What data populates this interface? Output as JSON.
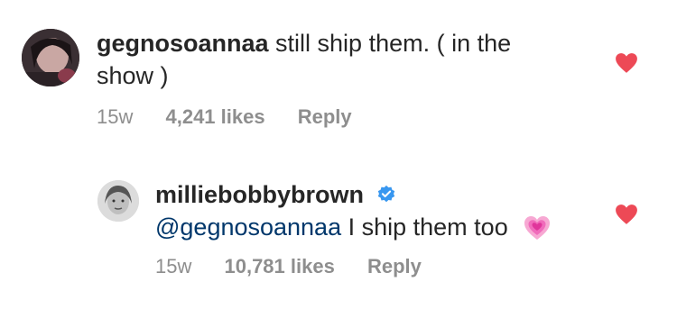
{
  "comments": [
    {
      "username": "gegnosoannaa",
      "text": "still ship them. ( in the show )",
      "time": "15w",
      "likes": "4,241 likes",
      "reply": "Reply",
      "avatar_icon": "profile-photo",
      "heart_color": "#ed4956"
    },
    {
      "username": "milliebobbybrown",
      "verified_icon": "verified-badge-icon",
      "mention": "@gegnosoannaa",
      "text": "I ship them too",
      "emoji_icon": "growing-heart-emoji",
      "time": "15w",
      "likes": "10,781 likes",
      "reply": "Reply",
      "avatar_icon": "profile-photo",
      "heart_color": "#ed4956"
    }
  ]
}
